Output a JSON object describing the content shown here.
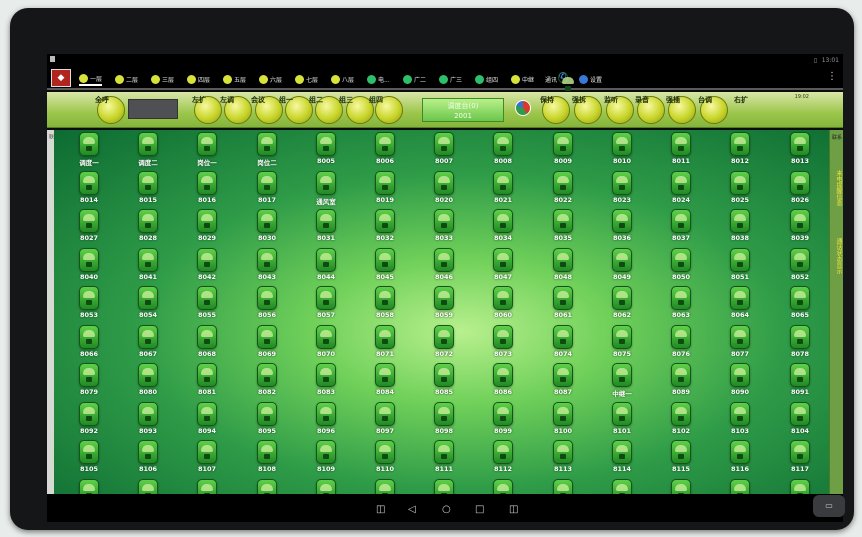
{
  "status": {
    "time": "13:01",
    "battery_icon": "battery-icon"
  },
  "app": {
    "logo": "logo"
  },
  "tabs": [
    {
      "label": "一层",
      "icon": "yellow-dot-icon",
      "active": true
    },
    {
      "label": "二层",
      "icon": "yellow-dot-icon"
    },
    {
      "label": "三层",
      "icon": "yellow-dot-icon"
    },
    {
      "label": "四层",
      "icon": "yellow-dot-icon"
    },
    {
      "label": "五层",
      "icon": "yellow-dot-icon"
    },
    {
      "label": "六层",
      "icon": "yellow-dot-icon"
    },
    {
      "label": "七层",
      "icon": "yellow-dot-icon"
    },
    {
      "label": "八层",
      "icon": "yellow-dot-icon"
    },
    {
      "label": "电...",
      "icon": "green-dot-icon"
    },
    {
      "label": "广二",
      "icon": "green-dot-icon"
    },
    {
      "label": "广三",
      "icon": "green-dot-icon"
    },
    {
      "label": "组四",
      "icon": "green-dot-icon"
    },
    {
      "label": "中继",
      "icon": "yellow-dot-icon"
    },
    {
      "label": "通讯",
      "icon": "phone-icon"
    },
    {
      "label": "设置",
      "icon": "settings-icon"
    }
  ],
  "toolbar": {
    "buttons": [
      "全呼",
      "左扩",
      "左调",
      "会议",
      "组一",
      "组二",
      "组三",
      "组四"
    ],
    "dispatch_line1": "调度台(0)",
    "dispatch_line2": "2001",
    "right_buttons": [
      "保持",
      "强拆",
      "监听",
      "录音",
      "强插",
      "台调",
      "右扩"
    ],
    "time": "19:02"
  },
  "grid_rows": [
    [
      "调度一",
      "调度二",
      "岗位一",
      "岗位二",
      "8005",
      "8006",
      "8007",
      "8008",
      "8009",
      "8010",
      "8011",
      "8012",
      "8013"
    ],
    [
      "8014",
      "8015",
      "8016",
      "8017",
      "通风室",
      "8019",
      "8020",
      "8021",
      "8022",
      "8023",
      "8024",
      "8025",
      "8026"
    ],
    [
      "8027",
      "8028",
      "8029",
      "8030",
      "8031",
      "8032",
      "8033",
      "8034",
      "8035",
      "8036",
      "8037",
      "8038",
      "8039"
    ],
    [
      "8040",
      "8041",
      "8042",
      "8043",
      "8044",
      "8045",
      "8046",
      "8047",
      "8048",
      "8049",
      "8050",
      "8051",
      "8052"
    ],
    [
      "8053",
      "8054",
      "8055",
      "8056",
      "8057",
      "8058",
      "8059",
      "8060",
      "8061",
      "8062",
      "8063",
      "8064",
      "8065"
    ],
    [
      "8066",
      "8067",
      "8068",
      "8069",
      "8070",
      "8071",
      "8072",
      "8073",
      "8074",
      "8075",
      "8076",
      "8077",
      "8078"
    ],
    [
      "8079",
      "8080",
      "8081",
      "8082",
      "8083",
      "8084",
      "8085",
      "8086",
      "8087",
      "中继一",
      "8089",
      "8090",
      "8091"
    ],
    [
      "8092",
      "8093",
      "8094",
      "8095",
      "8096",
      "8097",
      "8098",
      "8099",
      "8100",
      "8101",
      "8102",
      "8103",
      "8104"
    ],
    [
      "8105",
      "8106",
      "8107",
      "8108",
      "8109",
      "8110",
      "8111",
      "8112",
      "8113",
      "8114",
      "8115",
      "8116",
      "8117"
    ],
    [
      "",
      "",
      "",
      "",
      "",
      "",
      "",
      "",
      "",
      "",
      "",
      "",
      ""
    ]
  ],
  "side": {
    "left_label": "联",
    "right_top": "联系",
    "right_yellow1": "来电提醒信息",
    "right_yellow2": "通话状态显示"
  },
  "system_keys": [
    "volume-down-icon",
    "back-icon",
    "home-icon",
    "recents-icon",
    "volume-up-icon"
  ]
}
